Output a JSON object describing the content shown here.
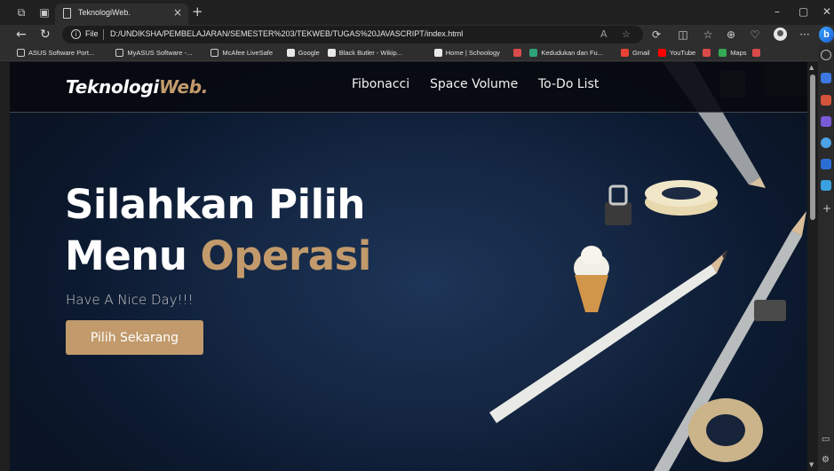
{
  "browser": {
    "tab_title": "TeknologiWeb.",
    "url_scheme": "File",
    "url": "D:/UNDIKSHA/PEMBELAJARAN/SEMESTER%203/TEKWEB/TUGAS%20JAVASCRIPT/index.html",
    "bookmarks": [
      {
        "label": "ASUS Software Port...",
        "icon": "page-icon",
        "color": "#cfcfcf"
      },
      {
        "label": "MyASUS Software -...",
        "icon": "page-icon",
        "color": "#cfcfcf"
      },
      {
        "label": "McAfee LiveSafe",
        "icon": "page-icon",
        "color": "#cfcfcf"
      },
      {
        "label": "Google",
        "icon": "google-icon",
        "color": "#e8e8e8"
      },
      {
        "label": "Black Butler - Wikip...",
        "icon": "wikipedia-icon",
        "color": "#e8e8e8"
      },
      {
        "label": "Home | Schoology",
        "icon": "schoology-icon",
        "color": "#e8e8e8"
      },
      {
        "label": "",
        "icon": "red-bookmark-icon",
        "color": "#d94a4a"
      },
      {
        "label": "Kedudukan dan Fu...",
        "icon": "green-bookmark-icon",
        "color": "#2fa37a"
      },
      {
        "label": "Gmail",
        "icon": "gmail-icon",
        "color": "#ea4335"
      },
      {
        "label": "YouTube",
        "icon": "youtube-icon",
        "color": "#ff0000"
      },
      {
        "label": "",
        "icon": "red-bookmark-icon",
        "color": "#d94a4a"
      },
      {
        "label": "Maps",
        "icon": "maps-icon",
        "color": "#34a853"
      },
      {
        "label": "",
        "icon": "red-bookmark-icon",
        "color": "#d94a4a"
      }
    ]
  },
  "page": {
    "logo_main": "Teknologi",
    "logo_accent": "Web.",
    "nav": [
      "Fibonacci",
      "Space Volume",
      "To-Do List"
    ],
    "hero_line1": "Silahkan Pilih",
    "hero_line2_main": "Menu ",
    "hero_line2_accent": "Operasi",
    "subtitle": "Have A Nice Day!!!",
    "cta_label": "Pilih Sekarang",
    "colors": {
      "accent": "#c29a6b",
      "navbar": "#0a0c12",
      "hero": "#142642"
    }
  }
}
